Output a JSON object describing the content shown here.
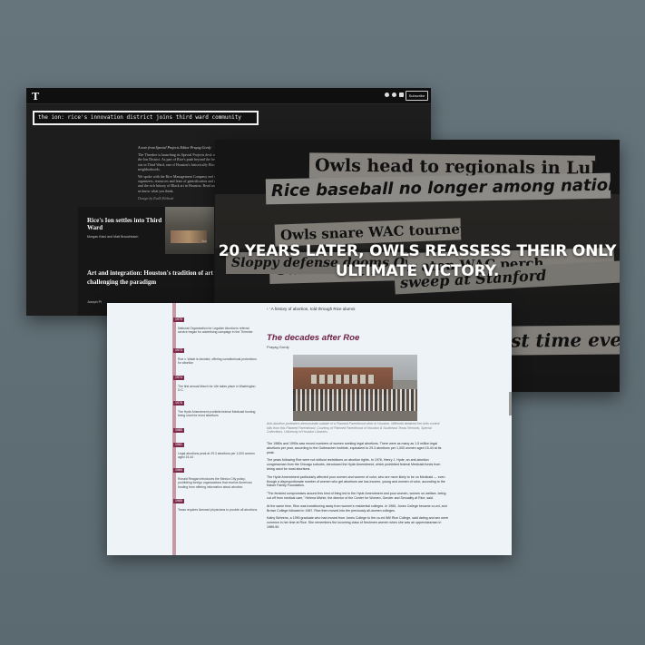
{
  "ion": {
    "logo": "T",
    "subscribe_label": "Subscribe",
    "title": "the ion: rice's innovation district joins third ward community",
    "note": "A note from Special Projects Editor Prayag Gordy",
    "p1": "The Thresher is launching its Special Projects desk with a look at the Ion District. As part of Rice's push beyond the hedges, the Ion sits in Third Ward, one of Houston's historically Black neighborhoods.",
    "p2": "We spoke with the Rice Management Company and community organizers, resources and fears of gentrification and displacement, and the rich history of Black art in Houston. Read more here and let us know what you think.",
    "credit": "Design by Fadli Elebesh",
    "card1_title": "Rice's Ion settles into Third Ward",
    "card1_author": "Morgan Kiani and Matt Brauchbach",
    "card1_author2": "Jun",
    "card2_title": "Art and integration: Houston's tradition of art challenging the paradigm",
    "card2_author": "Joseph Pl"
  },
  "owls": {
    "clip1": "Owls head to regionals in Lubbock",
    "clip2": "Rice baseball no longer among national elite",
    "clip3": "Owls snare WAC tourney title",
    "clip4": "Sloppy defense dooms Owls",
    "clip5": "sweep at Stanford",
    "clip6": "Owls sitting pretty atop WAC perch",
    "clip7": "st time ever",
    "headline": "20 YEARS LATER, OWLS REASSESS THEIR ONLY ULTIMATE VICTORY."
  },
  "roe": {
    "crumb": "‹ ' A history of abortion, told through Rice alumni",
    "title": "The decades after Roe",
    "author": "Prayag Gordy",
    "caption": "Anti-abortion protesters demonstrate outside of a Planned Parenthood clinic in Houston. Withheld detained her birth control bills from this Planned Parenthood. Courtesy of Planned Parenthood of Houston & Southeast Texas Records, Special Collections, University of Houston Libraries.",
    "body": [
      "The 1980s and 1990s saw record numbers of women seeking legal abortions. There were as many as 1.5 million legal abortions per year, according to the Guttmacher Institute, equivalent to 29.3 abortions per 1,000 women aged 15-44 at its peak.",
      "The years following Roe were not without restrictions on abortion rights. In 1976, Henry J. Hyde, an anti-abortion congressman from the Chicago suburbs, introduced the Hyde Amendment, which prohibited federal Medicaid funds from being used for most abortions.",
      "The Hyde Amendment particularly affected poor women and women of color, who are more likely to be on Medicaid — even though a disproportionate number of women who get abortions are low-income, young and women of color, according to the Kaiser Family Foundation.",
      "\"The feminist compromises around this kind of thing led to the Hyde Amendment and poor women, women on welfare, being cut off from medical care,\" Helena Michie, the director of the Center for Women, Gender and Sexuality at Rice, said.",
      "At the same time, Rice was transitioning away from women's residential colleges. In 1965, Jones College became co-ed, and Brown College followed in 1987. Rice then moved into the previously all-women colleges.",
      "Kathy Behrens, a 1990 graduate who had moved from Jones College to the co-ed Will Rice College, said dating and sex were common in her time at Rice. She remembers the incoming class of freshmen women when she was an upperclassman in 1989-90."
    ],
    "timeline": [
      {
        "year": "1970",
        "text": "National Organization for Legalize Abortion's referral service began for advertising campaign in the Thresher"
      },
      {
        "year": "1973",
        "text": "Roe v. Wade is decided, offering constitutional protections for abortion"
      },
      {
        "year": "1974",
        "text": "The first annual March for Life takes place in Washington, D.C."
      },
      {
        "year": "1976",
        "text": "The Hyde Amendment prohibits federal Medicaid funding being used for most abortions"
      },
      {
        "year": "1980",
        "text": ""
      },
      {
        "year": "1981",
        "text": "Legal abortions peak at 29.3 abortions per 1,000 women aged 15-44"
      },
      {
        "year": "1984",
        "text": "Ronald Reagan introduces the Mexico City policy, prohibiting foreign organizations that receive American funding from offering information about abortion"
      },
      {
        "year": "1985",
        "text": "Texas requires licensed physicians to provide all abortions"
      }
    ]
  }
}
